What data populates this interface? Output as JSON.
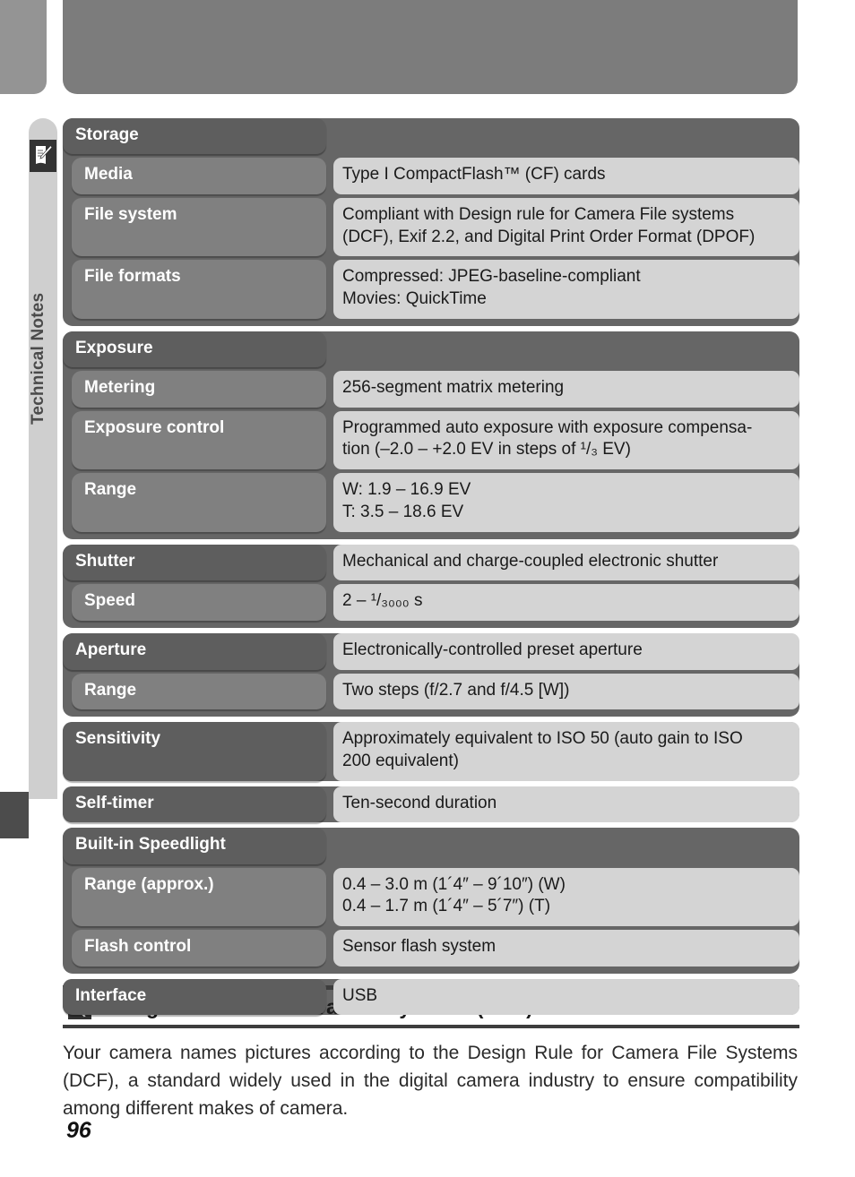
{
  "chapter_tab": {
    "label": "Technical Notes",
    "icon": "note-pen-icon"
  },
  "page_number": "96",
  "spec_table": {
    "groups": [
      {
        "name": "storage",
        "rows": [
          {
            "type": "section",
            "label": "Storage",
            "value_lines": []
          },
          {
            "type": "sub",
            "label": "Media",
            "value_lines": [
              "Type I CompactFlash™ (CF) cards"
            ]
          },
          {
            "type": "sub",
            "label": "File system",
            "value_lines": [
              "Compliant with Design rule for Camera File systems",
              "(DCF), Exif 2.2, and Digital Print Order Format (DPOF)"
            ]
          },
          {
            "type": "sub",
            "label": "File formats",
            "value_lines": [
              "Compressed: JPEG-baseline-compliant",
              "Movies: QuickTime"
            ]
          }
        ]
      },
      {
        "name": "exposure",
        "rows": [
          {
            "type": "section",
            "label": "Exposure",
            "value_lines": []
          },
          {
            "type": "sub",
            "label": "Metering",
            "value_lines": [
              "256-segment matrix metering"
            ]
          },
          {
            "type": "sub",
            "label": "Exposure control",
            "value_lines": [
              "Programmed auto exposure with exposure compensa-",
              "tion (–2.0 – +2.0 EV in steps of ¹/₃ EV)"
            ]
          },
          {
            "type": "sub",
            "label": "Range",
            "value_lines": [
              "W: 1.9 – 16.9 EV",
              "T: 3.5 – 18.6 EV"
            ]
          }
        ]
      },
      {
        "name": "shutter",
        "rows": [
          {
            "type": "section",
            "label": "Shutter",
            "value_lines": [
              "Mechanical and charge-coupled electronic shutter"
            ]
          },
          {
            "type": "sub",
            "label": "Speed",
            "value_lines": [
              "2 – ¹/₃₀₀₀ s"
            ]
          }
        ]
      },
      {
        "name": "aperture",
        "rows": [
          {
            "type": "section",
            "label": "Aperture",
            "value_lines": [
              "Electronically-controlled preset aperture"
            ]
          },
          {
            "type": "sub",
            "label": "Range",
            "value_lines": [
              "Two steps (f/2.7 and f/4.5 [W])"
            ]
          }
        ]
      },
      {
        "name": "sensitivity",
        "rows": [
          {
            "type": "section-solo",
            "label": "Sensitivity",
            "value_lines": [
              "Approximately equivalent to ISO 50 (auto gain to ISO",
              "200 equivalent)"
            ]
          }
        ]
      },
      {
        "name": "self-timer",
        "rows": [
          {
            "type": "section-solo",
            "label": "Self-timer",
            "value_lines": [
              "Ten-second duration"
            ]
          }
        ]
      },
      {
        "name": "built-in-speedlight",
        "rows": [
          {
            "type": "section",
            "label": "Built-in Speedlight",
            "value_lines": []
          },
          {
            "type": "sub",
            "label": "Range (approx.)",
            "value_lines": [
              "0.4 – 3.0 m (1´4″ – 9´10″) (W)",
              "0.4 – 1.7 m (1´4″ – 5´7″) (T)"
            ]
          },
          {
            "type": "sub",
            "label": "Flash control",
            "value_lines": [
              "Sensor flash system"
            ]
          }
        ]
      },
      {
        "name": "interface",
        "rows": [
          {
            "type": "section-solo",
            "label": "Interface",
            "value_lines": [
              "USB"
            ]
          }
        ]
      }
    ]
  },
  "note": {
    "icon": "lightbulb-icon",
    "title": "Design Rule for Camera File Systems (DCF)",
    "body": "Your camera names pictures according to the Design Rule for Camera File Systems (DCF), a standard widely used in the digital camera industry to ensure compatibility among different makes of camera."
  },
  "colors": {
    "section_band": "#666666",
    "section_label_pill": "#5e5e5e",
    "sub_label_pill": "#808080",
    "value_pill": "#d4d4d4",
    "tab": "#cfcfcf",
    "icon_box": "#333333",
    "rule": "#3d3d3d",
    "top_bar_left": "#949494",
    "top_bar_main": "#7c7c7c"
  }
}
